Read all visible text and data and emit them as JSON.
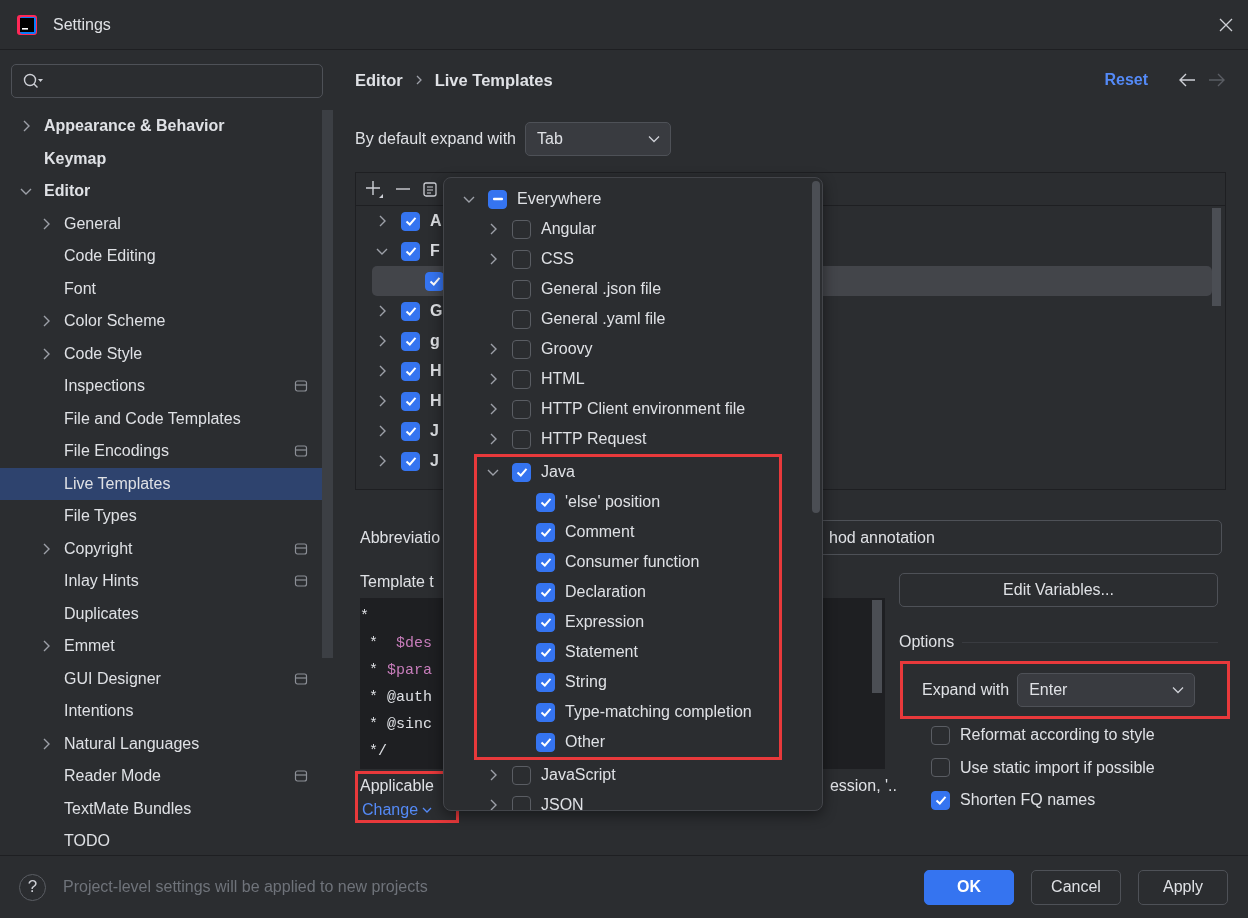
{
  "window": {
    "title": "Settings"
  },
  "sidebar": {
    "items": [
      {
        "label": "Appearance & Behavior",
        "expanded": false,
        "selected": false
      },
      {
        "label": "Keymap",
        "selected": false
      },
      {
        "label": "Editor",
        "expanded": true,
        "selected": false,
        "children": [
          {
            "label": "General",
            "expanded": false,
            "selected": false,
            "project_level": false
          },
          {
            "label": "Code Editing",
            "selected": false,
            "project_level": false
          },
          {
            "label": "Font",
            "selected": false,
            "project_level": false
          },
          {
            "label": "Color Scheme",
            "expanded": false,
            "selected": false,
            "project_level": false
          },
          {
            "label": "Code Style",
            "expanded": false,
            "selected": false,
            "project_level": false
          },
          {
            "label": "Inspections",
            "selected": false,
            "project_level": true
          },
          {
            "label": "File and Code Templates",
            "selected": false,
            "project_level": false
          },
          {
            "label": "File Encodings",
            "selected": false,
            "project_level": true
          },
          {
            "label": "Live Templates",
            "selected": true,
            "project_level": false
          },
          {
            "label": "File Types",
            "selected": false,
            "project_level": false
          },
          {
            "label": "Copyright",
            "expanded": false,
            "selected": false,
            "project_level": true
          },
          {
            "label": "Inlay Hints",
            "selected": false,
            "project_level": true
          },
          {
            "label": "Duplicates",
            "selected": false,
            "project_level": false
          },
          {
            "label": "Emmet",
            "expanded": false,
            "selected": false,
            "project_level": false
          },
          {
            "label": "GUI Designer",
            "selected": false,
            "project_level": true
          },
          {
            "label": "Intentions",
            "selected": false,
            "project_level": false
          },
          {
            "label": "Natural Languages",
            "expanded": false,
            "selected": false,
            "project_level": false
          },
          {
            "label": "Reader Mode",
            "selected": false,
            "project_level": true
          },
          {
            "label": "TextMate Bundles",
            "selected": false,
            "project_level": false
          },
          {
            "label": "TODO",
            "selected": false,
            "project_level": false
          }
        ]
      }
    ]
  },
  "breadcrumb": [
    "Editor",
    "Live Templates"
  ],
  "reset": "Reset",
  "navigation": {
    "back_disabled": false,
    "forward_disabled": true
  },
  "default_expand": {
    "label": "By default expand with",
    "value": "Tab"
  },
  "templates": {
    "rows": [
      {
        "label": "A",
        "checked": true,
        "expanded": false,
        "selected": false
      },
      {
        "label": "F",
        "checked": true,
        "expanded": true,
        "selected": false,
        "children": [
          {
            "checked": true,
            "selected": true
          }
        ]
      },
      {
        "label": "G",
        "checked": true,
        "expanded": false,
        "selected": false
      },
      {
        "label": "g",
        "checked": true,
        "expanded": false,
        "selected": false
      },
      {
        "label": "H",
        "checked": true,
        "expanded": false,
        "selected": false
      },
      {
        "label": "H",
        "checked": true,
        "expanded": false,
        "selected": false
      },
      {
        "label": "J",
        "checked": true,
        "expanded": false,
        "selected": false
      },
      {
        "label": "J",
        "checked": true,
        "expanded": false,
        "selected": false
      }
    ]
  },
  "abbreviation": {
    "label": "Abbreviatio",
    "value": "hod annotation"
  },
  "template_text": {
    "label": "Template t",
    "lines": [
      {
        "text": "*"
      },
      {
        "text": " *  ",
        "variable": "$des"
      },
      {
        "text": " * ",
        "variable": "$para"
      },
      {
        "text": " * @auth"
      },
      {
        "text": " * @sinc"
      },
      {
        "text": " */"
      }
    ]
  },
  "applicable": {
    "label": "Applicable",
    "contexts_tail": "ession, '..",
    "link": "Change",
    "highlighted": true
  },
  "edit_variables": "Edit Variables...",
  "options": {
    "title": "Options",
    "expand_with": {
      "label": "Expand with",
      "value": "Enter",
      "highlighted": true
    },
    "checkboxes": [
      {
        "label": "Reformat according to style",
        "checked": false
      },
      {
        "label": "Use static import if possible",
        "checked": false
      },
      {
        "label": "Shorten FQ names",
        "checked": true
      }
    ]
  },
  "contexts_popup": {
    "items": [
      {
        "label": "Everywhere",
        "expanded": true,
        "checked": false,
        "partial": true,
        "highlighted": false,
        "children": [
          {
            "label": "Angular",
            "expanded": false,
            "checked": false,
            "partial": false,
            "highlighted": false
          },
          {
            "label": "CSS",
            "expanded": false,
            "checked": false,
            "partial": false,
            "highlighted": false
          },
          {
            "label": "General .json file",
            "checked": false,
            "partial": false,
            "highlighted": false
          },
          {
            "label": "General .yaml file",
            "checked": false,
            "partial": false,
            "highlighted": false
          },
          {
            "label": "Groovy",
            "expanded": false,
            "checked": false,
            "partial": false,
            "highlighted": false
          },
          {
            "label": "HTML",
            "expanded": false,
            "checked": false,
            "partial": false,
            "highlighted": false
          },
          {
            "label": "HTTP Client environment file",
            "expanded": false,
            "checked": false,
            "partial": false,
            "highlighted": false
          },
          {
            "label": "HTTP Request",
            "expanded": false,
            "checked": false,
            "partial": false,
            "highlighted": false
          },
          {
            "label": "Java",
            "expanded": true,
            "checked": true,
            "partial": false,
            "highlighted": true,
            "children": [
              {
                "label": "'else' position",
                "checked": true,
                "partial": false,
                "highlighted": false
              },
              {
                "label": "Comment",
                "checked": true,
                "partial": false,
                "highlighted": false
              },
              {
                "label": "Consumer function",
                "checked": true,
                "partial": false,
                "highlighted": false
              },
              {
                "label": "Declaration",
                "checked": true,
                "partial": false,
                "highlighted": false
              },
              {
                "label": "Expression",
                "checked": true,
                "partial": false,
                "highlighted": false
              },
              {
                "label": "Statement",
                "checked": true,
                "partial": false,
                "highlighted": false
              },
              {
                "label": "String",
                "checked": true,
                "partial": false,
                "highlighted": false
              },
              {
                "label": "Type-matching completion",
                "checked": true,
                "partial": false,
                "highlighted": false
              },
              {
                "label": "Other",
                "checked": true,
                "partial": false,
                "highlighted": false
              }
            ]
          },
          {
            "label": "JavaScript",
            "expanded": false,
            "checked": false,
            "partial": false,
            "highlighted": false
          },
          {
            "label": "JSON",
            "expanded": false,
            "checked": false,
            "partial": false,
            "highlighted": false
          }
        ]
      }
    ]
  },
  "footer": {
    "help": "?",
    "note": "Project-level settings will be applied to new projects",
    "buttons": [
      {
        "label": "OK",
        "primary": true
      },
      {
        "label": "Cancel",
        "primary": false
      },
      {
        "label": "Apply",
        "primary": false
      }
    ]
  }
}
